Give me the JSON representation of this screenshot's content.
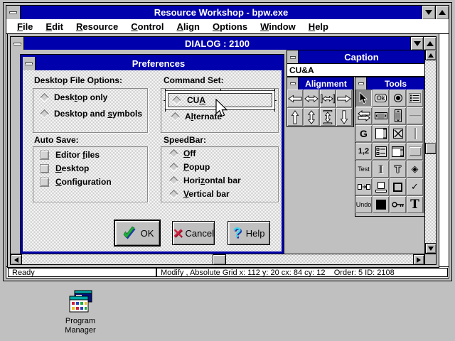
{
  "window": {
    "title": "Resource Workshop - bpw.exe"
  },
  "menu": {
    "items": [
      {
        "pre": "",
        "key": "F",
        "post": "ile"
      },
      {
        "pre": "",
        "key": "E",
        "post": "dit"
      },
      {
        "pre": "",
        "key": "R",
        "post": "esource"
      },
      {
        "pre": "",
        "key": "C",
        "post": "ontrol"
      },
      {
        "pre": "",
        "key": "A",
        "post": "lign"
      },
      {
        "pre": "",
        "key": "O",
        "post": "ptions"
      },
      {
        "pre": "",
        "key": "W",
        "post": "indow"
      },
      {
        "pre": "",
        "key": "H",
        "post": "elp"
      }
    ]
  },
  "dialog_window": {
    "title": "DIALOG : 2100"
  },
  "preferences": {
    "title": "Preferences",
    "desktop_file_options": {
      "label": "Desktop File Options:",
      "options": [
        {
          "pre": "Desk",
          "key": "t",
          "post": "op only"
        },
        {
          "pre": "Desktop and ",
          "key": "s",
          "post": "ymbols"
        }
      ]
    },
    "command_set": {
      "label": "Command Set:",
      "selected": "CUA",
      "options": [
        {
          "pre": "CU",
          "key": "A",
          "post": ""
        },
        {
          "pre": "A",
          "key": "l",
          "post": "ternate"
        }
      ]
    },
    "auto_save": {
      "label": "Auto Save:",
      "options": [
        {
          "pre": "Editor ",
          "key": "f",
          "post": "iles"
        },
        {
          "pre": "",
          "key": "D",
          "post": "esktop"
        },
        {
          "pre": "",
          "key": "C",
          "post": "onfiguration"
        }
      ]
    },
    "speedbar": {
      "label": "SpeedBar:",
      "options": [
        {
          "pre": "",
          "key": "O",
          "post": "ff"
        },
        {
          "pre": "",
          "key": "P",
          "post": "opup"
        },
        {
          "pre": "Hori",
          "key": "z",
          "post": "ontal bar"
        },
        {
          "pre": "",
          "key": "V",
          "post": "ertical bar"
        }
      ]
    },
    "buttons": {
      "ok": "OK",
      "cancel": "Cancel",
      "help": "Help"
    }
  },
  "caption_window": {
    "title": "Caption",
    "value": "CU&A"
  },
  "alignment_palette": {
    "title": "Alignment",
    "icons": [
      "arrow-left",
      "arrow-left-right",
      "space-horizontal",
      "arrow-right",
      "arrow-up",
      "arrow-up-down",
      "space-vertical",
      "arrow-down"
    ]
  },
  "tools_palette": {
    "title": "Tools",
    "selected_tool": "pointer",
    "labels": {
      "ok_button": "Ok",
      "group_box": "G",
      "numbers": "1,2",
      "static_text": "Test",
      "undo": "Undo",
      "outline_t": "T",
      "serif_t": "T"
    }
  },
  "status_bar": {
    "ready": "Ready",
    "info": "Modify , Absolute Grid x: 112 y: 20 cx: 84 cy: 12    Order: 5 ID: 2108"
  },
  "desktop_icon": {
    "line1": "Program",
    "line2": "Manager"
  },
  "colors": {
    "titlebar": "#0000ad",
    "desktop": "#c0c0c0",
    "ok_check": "#1fae3c",
    "cancel_x": "#cf1f3c",
    "help_q": "#41d6e8"
  }
}
